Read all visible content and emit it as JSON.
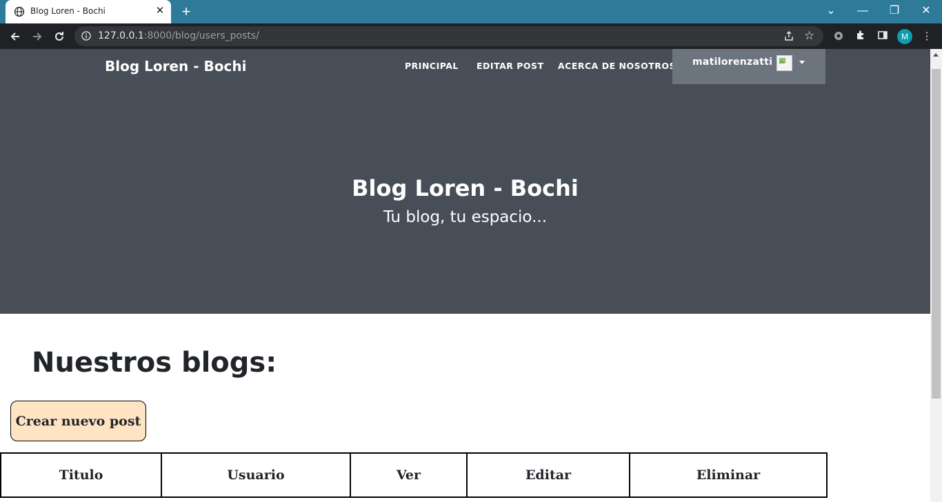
{
  "browser": {
    "tab_title": "Blog Loren - Bochi",
    "tab_close": "✕",
    "new_tab": "+",
    "url_host": "127.0.0.1",
    "url_rest": ":8000/blog/users_posts/",
    "profile_initial": "M",
    "window_controls": {
      "minimize": "—",
      "restore": "❐",
      "close": "✕",
      "tab_search": "⌄"
    }
  },
  "navbar": {
    "brand": "Blog Loren - Bochi",
    "links": [
      "PRINCIPAL",
      "EDITAR POST",
      "ACERCA DE NOSOTROS"
    ],
    "username": "matilorenzatti"
  },
  "hero": {
    "title": "Blog Loren - Bochi",
    "subtitle": "Tu blog, tu espacio..."
  },
  "main": {
    "heading": "Nuestros blogs:",
    "create_button": "Crear nuevo post",
    "table": {
      "headers": [
        "Titulo",
        "Usuario",
        "Ver",
        "Editar",
        "Eliminar"
      ]
    }
  },
  "colors": {
    "tab_strip": "#2e7a99",
    "hero_bg": "#474e57",
    "user_box": "#6c757d",
    "button_bg": "#ffe4c4"
  }
}
